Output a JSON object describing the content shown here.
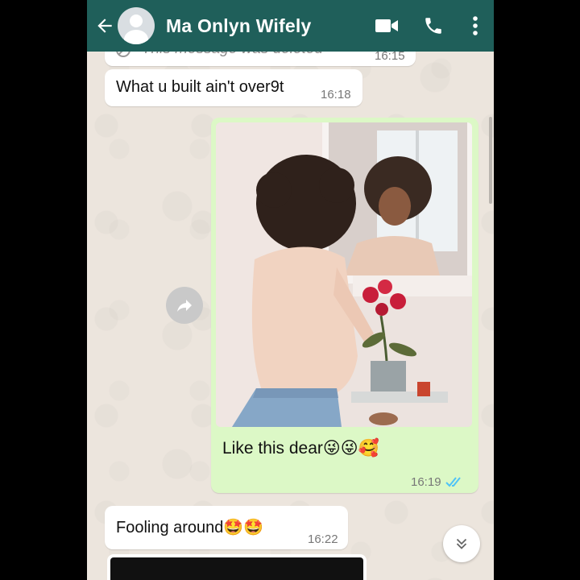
{
  "header": {
    "back_icon": "arrow-left-icon",
    "contact_name": "Ma Onlyn Wifely",
    "video_icon": "video-camera-icon",
    "call_icon": "phone-icon",
    "menu_icon": "more-vertical-icon",
    "color": "#1f5f5a"
  },
  "messages": [
    {
      "type": "deleted",
      "text": "This message was deleted",
      "time": "16:15"
    },
    {
      "type": "incoming",
      "text": "What u built ain't over9t",
      "time": "16:18"
    },
    {
      "type": "outgoing-image",
      "caption": "Like  this dear😜😜🥰",
      "time": "16:19",
      "status": "read",
      "status_icon": "double-check-icon"
    },
    {
      "type": "incoming",
      "text": "Fooling around🤩🤩",
      "time": "16:22"
    }
  ],
  "controls": {
    "forward_icon": "forward-icon",
    "scroll_down_icon": "chevron-double-down-icon"
  },
  "colors": {
    "outgoing_bubble": "#dcf8c6",
    "incoming_bubble": "#ffffff",
    "read_ticks": "#4fc3f7",
    "wallpaper": "#ece5dd"
  }
}
